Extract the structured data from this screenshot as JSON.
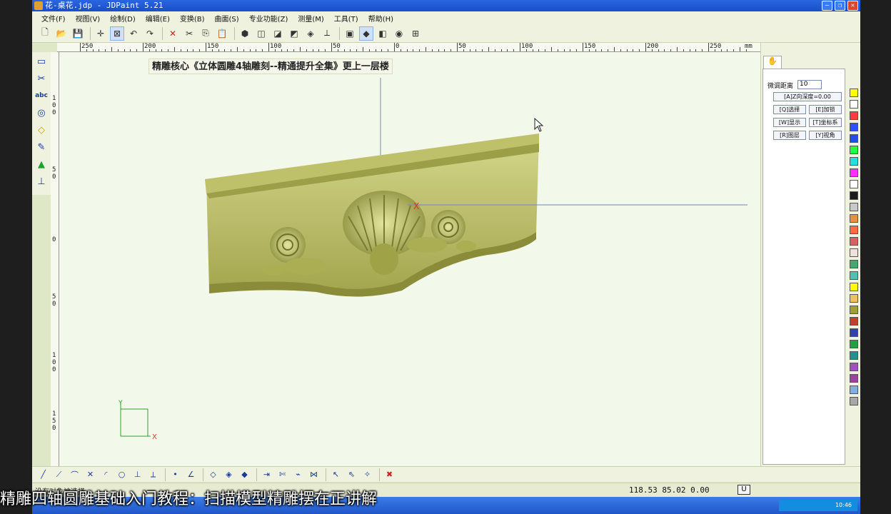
{
  "window": {
    "title": "花-桌花.jdp - JDPaint 5.21"
  },
  "menu": [
    "文件(F)",
    "视图(V)",
    "绘制(D)",
    "编辑(E)",
    "变换(B)",
    "曲面(S)",
    "专业功能(Z)",
    "测量(M)",
    "工具(T)",
    "帮助(H)"
  ],
  "toolbar_icons": [
    "new-file-icon",
    "open-folder-icon",
    "save-icon",
    "crosshair-icon",
    "window-select-icon",
    "undo-icon",
    "redo-icon",
    "delete-icon",
    "cut-icon",
    "copy-icon",
    "paste-icon",
    "solid-view-icon",
    "wire-box-icon",
    "shade-box-icon",
    "iso-view-icon",
    "layers-icon",
    "axis-icon",
    "cube-front-icon",
    "cube-blue-icon",
    "cube-side-icon",
    "render-icon",
    "snap-grid-icon"
  ],
  "ruler": {
    "labels": [
      "250",
      "200",
      "150",
      "100",
      "50",
      "0",
      "50",
      "100",
      "150",
      "200",
      "250"
    ],
    "unit": "mm"
  },
  "vruler_labels": [
    "1",
    "0",
    "0",
    "5",
    "0",
    "0",
    "5",
    "0",
    "1",
    "0",
    "0",
    "1",
    "5",
    "0"
  ],
  "left_tools": [
    "rectangle-select-icon",
    "trim-icon",
    "text-abc-icon",
    "circle-tool-icon",
    "diamond-tool-icon",
    "brush-icon",
    "cone-green-icon",
    "measure-icon"
  ],
  "canvas": {
    "banner": "精雕核心《立体圆雕4轴雕刻--精通提升全集》更上一层楼",
    "axis_x_label": "X",
    "axis_y_label": "Y",
    "origin_marker": "X"
  },
  "right_panel": {
    "tab_icon": "hand-icon",
    "nudge_label": "微调距离",
    "nudge_value": "10",
    "z_depth_button": "[A]Z向深度=0.00",
    "buttons": [
      [
        "[Q]选择",
        "[E]加锁"
      ],
      [
        "[W]显示",
        "[T]坐标系"
      ],
      [
        "[R]图层",
        "[Y]视角"
      ]
    ]
  },
  "palette_colors": [
    "#ffff00",
    "#ffffff",
    "#ff3b3b",
    "#3050ff",
    "#2050e0",
    "#20ff40",
    "#20e0e0",
    "#ff30ff",
    "#ffffff",
    "#1a1a1a",
    "#c8c8c8",
    "#e89040",
    "#ff6a40",
    "#d86060",
    "#f0e0e0",
    "#40a870",
    "#50c0b0",
    "#ffff00",
    "#f0c060",
    "#a0a030",
    "#c04030",
    "#3040b0",
    "#20a040",
    "#209090",
    "#a050c0",
    "#a040a0",
    "#80b0e0",
    "#a8a8a8"
  ],
  "bottom_tools": [
    "line-icon",
    "polyline-icon",
    "arc-icon",
    "cross-icon",
    "fillet-icon",
    "circle-icon",
    "perpendicular-icon",
    "tangent-icon",
    "point-icon",
    "angle-icon",
    "node-edit-icon",
    "node-add-icon",
    "node-delete-icon",
    "extend-icon",
    "trim-curve-icon",
    "break-icon",
    "join-icon",
    "pick-icon",
    "pick-multi-icon",
    "magic-icon",
    "close-red-icon"
  ],
  "status": {
    "message": "没有对象被选择",
    "coords": "118.53 85.02 0.00",
    "unit_button": "U"
  },
  "taskbar": {
    "clock": "10:46"
  },
  "subtitle": "精雕四轴圆雕基础入门教程：扫描模型精雕摆在正讲解"
}
